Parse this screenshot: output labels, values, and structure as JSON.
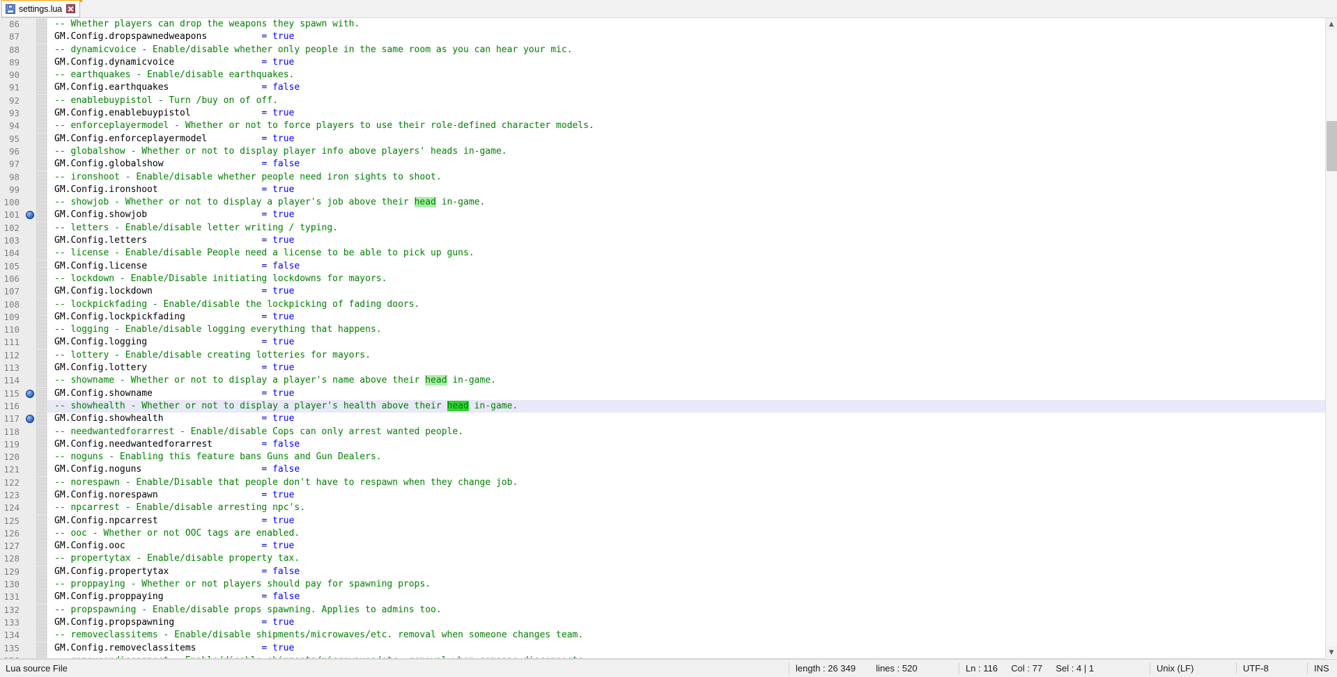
{
  "app": "Notepad++",
  "tab": {
    "title": "settings.lua",
    "save_icon": "floppy-disk-icon",
    "close_icon": "close-icon",
    "accent_color": "#ffa000",
    "modified": false
  },
  "editor": {
    "language": "Lua",
    "first_visible_line": 86,
    "current_line": 116,
    "search_term": "head",
    "bookmarked_lines": [
      101,
      115,
      117
    ],
    "colors": {
      "comment": "#008000",
      "identifier": "#000000",
      "operator": "#0000c0",
      "keyword": "#0000ff",
      "smart_highlight": "#a8f0a8",
      "selected_match": "#33d133",
      "current_line_bg": "#e8e8f8",
      "margin_bg": "#ececec",
      "line_number": "#808080"
    },
    "lines": [
      {
        "n": 86,
        "type": "comment",
        "text": "-- Whether players can drop the weapons they spawn with."
      },
      {
        "n": 87,
        "type": "assign",
        "name": "GM.Config.dropspawnedweapons",
        "value": "true"
      },
      {
        "n": 88,
        "type": "comment",
        "text": "-- dynamicvoice - Enable/disable whether only people in the same room as you can hear your mic."
      },
      {
        "n": 89,
        "type": "assign",
        "name": "GM.Config.dynamicvoice",
        "value": "true"
      },
      {
        "n": 90,
        "type": "comment",
        "text": "-- earthquakes - Enable/disable earthquakes."
      },
      {
        "n": 91,
        "type": "assign",
        "name": "GM.Config.earthquakes",
        "value": "false"
      },
      {
        "n": 92,
        "type": "comment",
        "text": "-- enablebuypistol - Turn /buy on of off."
      },
      {
        "n": 93,
        "type": "assign",
        "name": "GM.Config.enablebuypistol",
        "value": "true"
      },
      {
        "n": 94,
        "type": "comment",
        "text": "-- enforceplayermodel - Whether or not to force players to use their role-defined character models."
      },
      {
        "n": 95,
        "type": "assign",
        "name": "GM.Config.enforceplayermodel",
        "value": "true"
      },
      {
        "n": 96,
        "type": "comment",
        "text": "-- globalshow - Whether or not to display player info above players' heads in-game."
      },
      {
        "n": 97,
        "type": "assign",
        "name": "GM.Config.globalshow",
        "value": "false"
      },
      {
        "n": 98,
        "type": "comment",
        "text": "-- ironshoot - Enable/disable whether people need iron sights to shoot."
      },
      {
        "n": 99,
        "type": "assign",
        "name": "GM.Config.ironshoot",
        "value": "true"
      },
      {
        "n": 100,
        "type": "comment",
        "pre": "-- showjob - Whether or not to display a player's job above their ",
        "mark": "head",
        "post": " in-game."
      },
      {
        "n": 101,
        "type": "assign",
        "name": "GM.Config.showjob",
        "value": "true",
        "bookmark": true
      },
      {
        "n": 102,
        "type": "comment",
        "text": "-- letters - Enable/disable letter writing / typing."
      },
      {
        "n": 103,
        "type": "assign",
        "name": "GM.Config.letters",
        "value": "true"
      },
      {
        "n": 104,
        "type": "comment",
        "text": "-- license - Enable/disable People need a license to be able to pick up guns."
      },
      {
        "n": 105,
        "type": "assign",
        "name": "GM.Config.license",
        "value": "false"
      },
      {
        "n": 106,
        "type": "comment",
        "text": "-- lockdown - Enable/Disable initiating lockdowns for mayors."
      },
      {
        "n": 107,
        "type": "assign",
        "name": "GM.Config.lockdown",
        "value": "true"
      },
      {
        "n": 108,
        "type": "comment",
        "text": "-- lockpickfading - Enable/disable the lockpicking of fading doors."
      },
      {
        "n": 109,
        "type": "assign",
        "name": "GM.Config.lockpickfading",
        "value": "true"
      },
      {
        "n": 110,
        "type": "comment",
        "text": "-- logging - Enable/disable logging everything that happens."
      },
      {
        "n": 111,
        "type": "assign",
        "name": "GM.Config.logging",
        "value": "true"
      },
      {
        "n": 112,
        "type": "comment",
        "text": "-- lottery - Enable/disable creating lotteries for mayors."
      },
      {
        "n": 113,
        "type": "assign",
        "name": "GM.Config.lottery",
        "value": "true"
      },
      {
        "n": 114,
        "type": "comment",
        "pre": "-- showname - Whether or not to display a player's name above their ",
        "mark": "head",
        "post": " in-game."
      },
      {
        "n": 115,
        "type": "assign",
        "name": "GM.Config.showname",
        "value": "true",
        "bookmark": true
      },
      {
        "n": 116,
        "type": "comment",
        "pre": "-- showhealth - Whether or not to display a player's health above their ",
        "mark": "head",
        "post": " in-game.",
        "current": true,
        "mark_selected": true
      },
      {
        "n": 117,
        "type": "assign",
        "name": "GM.Config.showhealth",
        "value": "true",
        "bookmark": true
      },
      {
        "n": 118,
        "type": "comment",
        "text": "-- needwantedforarrest - Enable/disable Cops can only arrest wanted people."
      },
      {
        "n": 119,
        "type": "assign",
        "name": "GM.Config.needwantedforarrest",
        "value": "false"
      },
      {
        "n": 120,
        "type": "comment",
        "text": "-- noguns - Enabling this feature bans Guns and Gun Dealers."
      },
      {
        "n": 121,
        "type": "assign",
        "name": "GM.Config.noguns",
        "value": "false"
      },
      {
        "n": 122,
        "type": "comment",
        "text": "-- norespawn - Enable/Disable that people don't have to respawn when they change job."
      },
      {
        "n": 123,
        "type": "assign",
        "name": "GM.Config.norespawn",
        "value": "true"
      },
      {
        "n": 124,
        "type": "comment",
        "text": "-- npcarrest - Enable/disable arresting npc's."
      },
      {
        "n": 125,
        "type": "assign",
        "name": "GM.Config.npcarrest",
        "value": "true"
      },
      {
        "n": 126,
        "type": "comment",
        "text": "-- ooc - Whether or not OOC tags are enabled."
      },
      {
        "n": 127,
        "type": "assign",
        "name": "GM.Config.ooc",
        "value": "true"
      },
      {
        "n": 128,
        "type": "comment",
        "text": "-- propertytax - Enable/disable property tax."
      },
      {
        "n": 129,
        "type": "assign",
        "name": "GM.Config.propertytax",
        "value": "false"
      },
      {
        "n": 130,
        "type": "comment",
        "text": "-- proppaying - Whether or not players should pay for spawning props."
      },
      {
        "n": 131,
        "type": "assign",
        "name": "GM.Config.proppaying",
        "value": "false"
      },
      {
        "n": 132,
        "type": "comment",
        "text": "-- propspawning - Enable/disable props spawning. Applies to admins too."
      },
      {
        "n": 133,
        "type": "assign",
        "name": "GM.Config.propspawning",
        "value": "true"
      },
      {
        "n": 134,
        "type": "comment",
        "text": "-- removeclassitems - Enable/disable shipments/microwaves/etc. removal when someone changes team."
      },
      {
        "n": 135,
        "type": "assign",
        "name": "GM.Config.removeclassitems",
        "value": "true"
      },
      {
        "n": 136,
        "type": "comment",
        "text": "-- removeondisconnect - Enable/disable shipments/microwaves/etc. removal when someone disconnects."
      }
    ]
  },
  "scrollbars": {
    "vertical_up_arrow": "▲",
    "vertical_down_arrow": "▼"
  },
  "statusbar": {
    "doc_type": "Lua source File",
    "length_label": "length :",
    "length_value": "26 349",
    "lines_label": "lines :",
    "lines_value": "520",
    "ln_label": "Ln :",
    "ln_value": "116",
    "col_label": "Col :",
    "col_value": "77",
    "sel_label": "Sel :",
    "sel_value": "4 | 1",
    "eol": "Unix (LF)",
    "encoding": "UTF-8",
    "mode": "INS"
  }
}
